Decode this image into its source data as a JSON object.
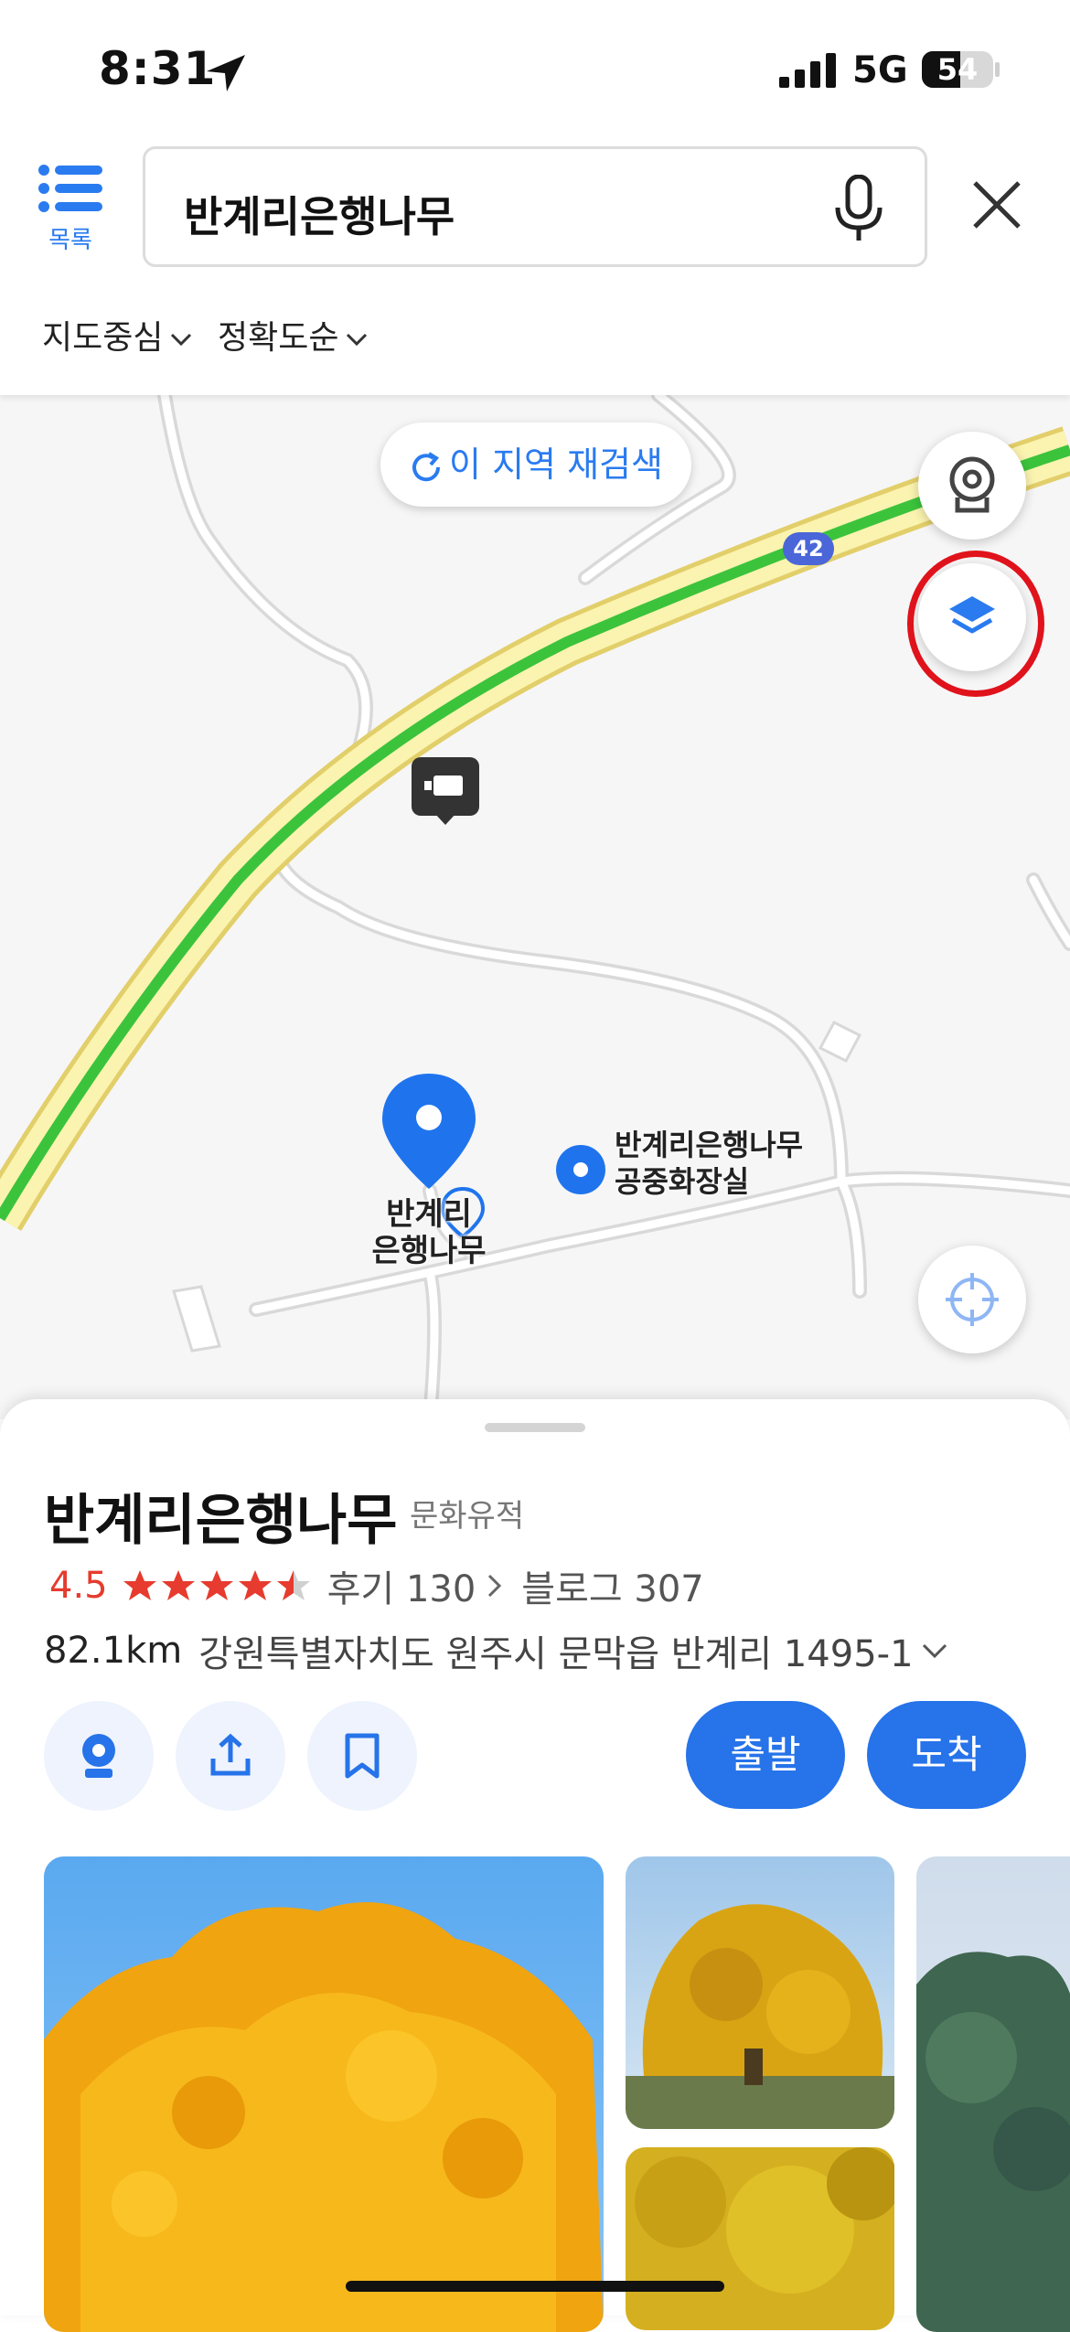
{
  "status": {
    "time": "8:31",
    "network": "5G",
    "battery": "54",
    "battery_level": 0.54
  },
  "header": {
    "list_label": "목록",
    "search_value": "반계리은행나무",
    "filters": [
      "지도중심",
      "정확도순"
    ]
  },
  "map": {
    "research_label": "이 지역 재검색",
    "route_badge": "42",
    "pin_label_line1": "반계리",
    "pin_label_line2": "은행나무",
    "poi_line1": "반계리은행나무",
    "poi_line2": "공중화장실"
  },
  "place": {
    "name": "반계리은행나무",
    "category": "문화유적",
    "rating": "4.5",
    "rating_value": 4.5,
    "review": "후기 130",
    "blog": "블로그 307",
    "distance": "82.1km",
    "address": "강원특별자치도 원주시 문막읍 반계리 1495-1",
    "start_label": "출발",
    "arrive_label": "도착"
  },
  "colors": {
    "accent": "#2673EA",
    "rating": "#E63B2E",
    "route_green": "#3CC33C",
    "highlight_circle": "#E0121B"
  }
}
